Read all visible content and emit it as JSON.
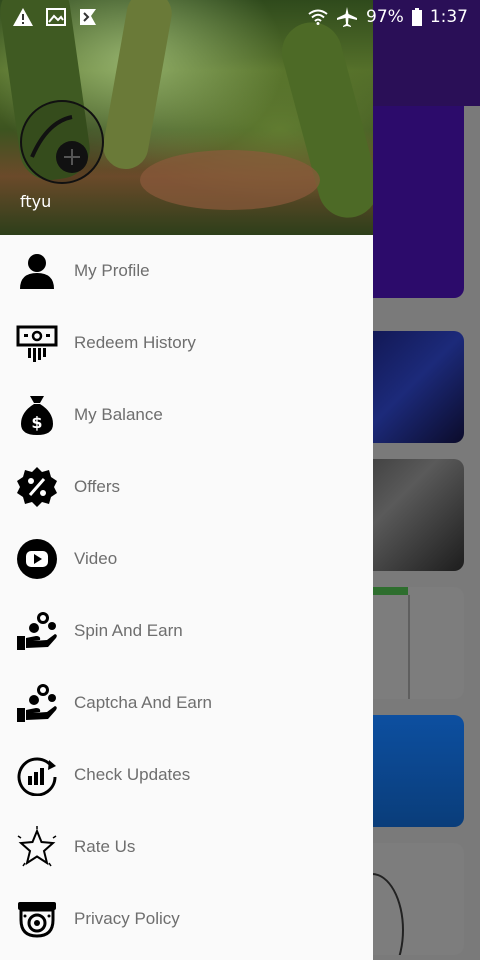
{
  "status_bar": {
    "battery": "97%",
    "time": "1:37",
    "icons": [
      "warning-icon",
      "image-icon",
      "flag-icon",
      "wifi-icon",
      "airplane-icon",
      "battery-icon"
    ]
  },
  "drawer": {
    "user_name": "ftyu",
    "items": [
      {
        "label": "My Profile",
        "icon": "person-icon"
      },
      {
        "label": "Redeem History",
        "icon": "money-icon"
      },
      {
        "label": "My Balance",
        "icon": "money-bag-icon"
      },
      {
        "label": "Offers",
        "icon": "percent-badge-icon"
      },
      {
        "label": "Video",
        "icon": "play-icon"
      },
      {
        "label": "Spin And Earn",
        "icon": "hand-coins-icon"
      },
      {
        "label": "Captcha And Earn",
        "icon": "hand-coins-icon"
      },
      {
        "label": "Check Updates",
        "icon": "update-chart-icon"
      },
      {
        "label": "Rate Us",
        "icon": "star-icon"
      },
      {
        "label": "Privacy Policy",
        "icon": "camera-icon"
      }
    ]
  },
  "colors": {
    "header_purple": "#2a0f57",
    "drawer_bg": "#fafafa",
    "label_gray": "#6e6e6e"
  }
}
